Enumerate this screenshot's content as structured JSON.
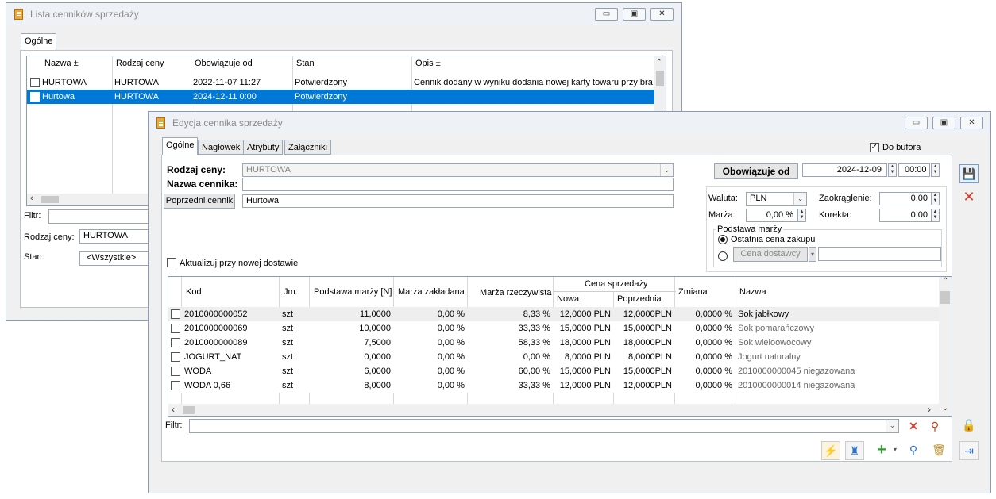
{
  "back_window": {
    "title": "Lista cenników sprzedaży",
    "tab": "Ogólne",
    "columns": [
      "Nazwa ±",
      "Rodzaj ceny",
      "Obowiązuje od",
      "Stan",
      "Opis ±"
    ],
    "rows": [
      {
        "name": "HURTOWA",
        "type": "HURTOWA",
        "from": "2022-11-07 11:27",
        "state": "Potwierdzony",
        "desc": "Cennik dodany w wyniku dodania nowej karty towaru przy bra"
      },
      {
        "name": "Hurtowa",
        "type": "HURTOWA",
        "from": "2024-12-11  0:00",
        "state": "Potwierdzony",
        "desc": ""
      }
    ],
    "selected_row": 1,
    "filter_label": "Filtr:",
    "rodzaj_label": "Rodzaj ceny:",
    "rodzaj_value": "HURTOWA",
    "stan_label": "Stan:",
    "stan_value": "<Wszystkie>"
  },
  "front_window": {
    "title": "Edycja cennika sprzedaży",
    "tabs": [
      "Ogólne",
      "Nagłówek",
      "Atrybuty",
      "Załączniki"
    ],
    "do_bufora": "Do bufora",
    "do_bufora_checked": true,
    "rodzaj_label": "Rodzaj ceny:",
    "rodzaj_value": "HURTOWA",
    "nazwa_label": "Nazwa cennika:",
    "nazwa_value": "",
    "poprzedni_button": "Poprzedni cennik",
    "poprzedni_value": "Hurtowa",
    "obowiazuje_button": "Obowiązuje od",
    "date_value": "2024-12-09",
    "time_value": "00:00",
    "waluta_label": "Waluta:",
    "waluta_value": "PLN",
    "zaokraglenie_label": "Zaokrąglenie:",
    "zaokraglenie_value": "0,00",
    "marza_label": "Marża:",
    "marza_value": "0,00 %",
    "korekta_label": "Korekta:",
    "korekta_value": "0,00",
    "podstawa_label": "Podstawa marży",
    "radio_ostatnia": "Ostatnia cena zakupu",
    "radio_cena_dostawcy": "Cena dostawcy",
    "aktualizuj_label": "Aktualizuj przy nowej dostawie",
    "grid": {
      "headers": {
        "kod": "Kod",
        "jm": "Jm.",
        "podstawa": "Podstawa marży [N]",
        "zakladana": "Marża zakładana",
        "rzeczywista": "Marża rzeczywista",
        "cena_group": "Cena sprzedaży",
        "nowa": "Nowa",
        "poprzednia": "Poprzednia",
        "zmiana": "Zmiana",
        "nazwa": "Nazwa"
      },
      "rows": [
        {
          "kod": "2010000000052",
          "jm": "szt",
          "podstawa": "11,0000",
          "zakladana": "0,00 %",
          "rzeczywista": "8,33 %",
          "nowa": "12,0000 PLN",
          "poprzednia": "12,0000PLN",
          "zmiana": "0,0000 %",
          "nazwa": "Sok jabłkowy"
        },
        {
          "kod": "2010000000069",
          "jm": "szt",
          "podstawa": "10,0000",
          "zakladana": "0,00 %",
          "rzeczywista": "33,33 %",
          "nowa": "15,0000 PLN",
          "poprzednia": "15,0000PLN",
          "zmiana": "0,0000 %",
          "nazwa": "Sok pomarańczowy"
        },
        {
          "kod": "2010000000089",
          "jm": "szt",
          "podstawa": "7,5000",
          "zakladana": "0,00 %",
          "rzeczywista": "58,33 %",
          "nowa": "18,0000 PLN",
          "poprzednia": "18,0000PLN",
          "zmiana": "0,0000 %",
          "nazwa": "Sok wieloowocowy"
        },
        {
          "kod": "JOGURT_NAT",
          "jm": "szt",
          "podstawa": "0,0000",
          "zakladana": "0,00 %",
          "rzeczywista": "0,00 %",
          "nowa": "8,0000 PLN",
          "poprzednia": "8,0000PLN",
          "zmiana": "0,0000 %",
          "nazwa": "Jogurt naturalny"
        },
        {
          "kod": "WODA",
          "jm": "szt",
          "podstawa": "6,0000",
          "zakladana": "0,00 %",
          "rzeczywista": "60,00 %",
          "nowa": "15,0000 PLN",
          "poprzednia": "15,0000PLN",
          "zmiana": "0,0000 %",
          "nazwa": "2010000000045 niegazowana"
        },
        {
          "kod": "WODA 0,66",
          "jm": "szt",
          "podstawa": "8,0000",
          "zakladana": "0,00 %",
          "rzeczywista": "33,33 %",
          "nowa": "12,0000 PLN",
          "poprzednia": "12,0000PLN",
          "zmiana": "0,0000 %",
          "nazwa": "2010000000014 niegazowana"
        }
      ]
    },
    "filter_label": "Filtr:"
  },
  "colors": {
    "selection": "#0078d7",
    "accent_red": "#d83a2e",
    "accent_blue": "#2a6fc9"
  }
}
